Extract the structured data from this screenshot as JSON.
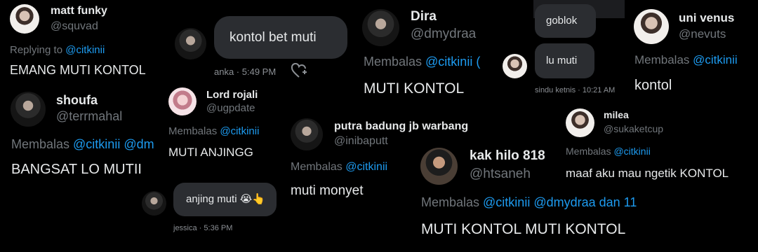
{
  "t1": {
    "name": "matt funky",
    "handle": "@squvad",
    "reply_prefix": "Replying to ",
    "reply_mention": "@citkinii",
    "text": "EMANG MUTI KONTOL"
  },
  "t2": {
    "name": "shoufa",
    "handle": "@terrmahal",
    "reply_prefix": "Membalas ",
    "reply_mention": "@citkinii @dm",
    "text": "BANGSAT LO MUTII"
  },
  "t3": {
    "bubble": "kontol bet muti",
    "meta": "anka · 5:49 PM"
  },
  "t4": {
    "name": "Lord rojali",
    "handle": "@ugpdate",
    "reply_prefix": "Membalas ",
    "reply_mention": "@citkinii",
    "text": "MUTI ANJINGG"
  },
  "t5": {
    "bubble": "anjing muti 😭👆",
    "meta": "jessica · 5:36 PM"
  },
  "t6": {
    "name": "Dira",
    "handle": "@dmydraa",
    "reply_prefix": "Membalas ",
    "reply_mention": "@citkinii (",
    "text": "MUTI KONTOL"
  },
  "t7": {
    "name": "putra badung jb warbang",
    "handle": "@inibaputt",
    "reply_prefix": "Membalas ",
    "reply_mention": "@citkinii",
    "text": "muti monyet"
  },
  "t8": {
    "name": "kak hilo 818",
    "handle": "@htsaneh",
    "reply_prefix": "Membalas ",
    "reply_mention": "@citkinii @dmydraa dan 11",
    "text": "MUTI KONTOL MUTI KONTOL"
  },
  "t9": {
    "bubble1": "goblok",
    "bubble2": "lu muti",
    "meta": "sindu ketnis · 10:21 AM"
  },
  "t10": {
    "name": "uni venus",
    "handle": "@nevuts",
    "reply_prefix": "Membalas ",
    "reply_mention": "@citkinii",
    "text": "kontol"
  },
  "t11": {
    "name": "milea",
    "handle": "@sukaketcup",
    "reply_prefix": "Membalas ",
    "reply_mention": "@citkinii",
    "text": "maaf aku mau ngetik KONTOL"
  },
  "icons": {
    "heart": "heart-plus-icon"
  }
}
